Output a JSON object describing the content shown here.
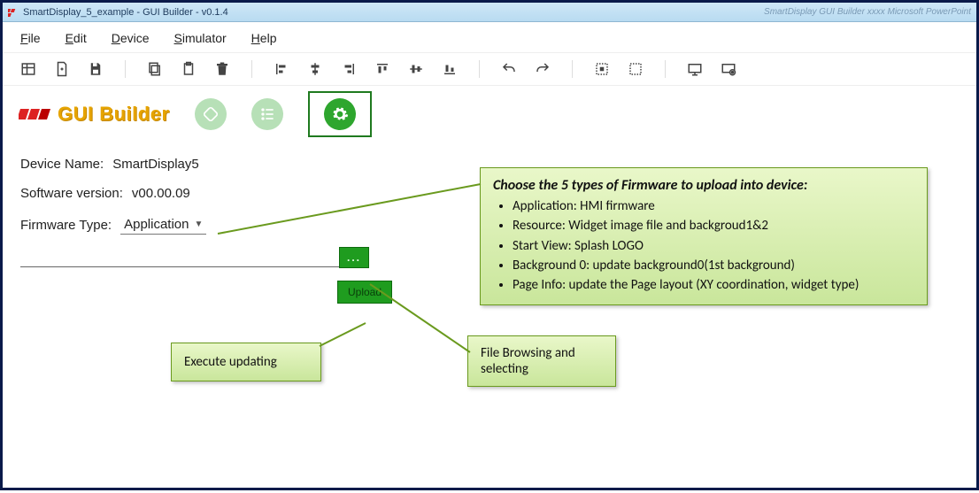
{
  "window": {
    "title": "SmartDisplay_5_example - GUI Builder - v0.1.4",
    "ghost_title": "SmartDisplay GUI Builder xxxx    Microsoft PowerPoint"
  },
  "menu": {
    "file": "File",
    "edit": "Edit",
    "device": "Device",
    "simulator": "Simulator",
    "help": "Help"
  },
  "brand": {
    "text": "GUI Builder"
  },
  "info": {
    "device_label": "Device Name:",
    "device_value": "SmartDisplay5",
    "version_label": "Software version:",
    "version_value": "v00.00.09",
    "fw_label": "Firmware Type:",
    "fw_value": "Application"
  },
  "buttons": {
    "browse": "...",
    "upload": "Upload"
  },
  "callouts": {
    "main_title": "Choose the 5 types of  Firmware to upload into device:",
    "items": [
      "Application: HMI firmware",
      "Resource: Widget image file and backgroud1&2",
      "Start View: Splash LOGO",
      "Background 0: update background0(1st background)",
      "Page Info: update the Page layout (XY coordination, widget type)"
    ],
    "browse": "File Browsing and selecting",
    "exec": "Execute updating"
  }
}
